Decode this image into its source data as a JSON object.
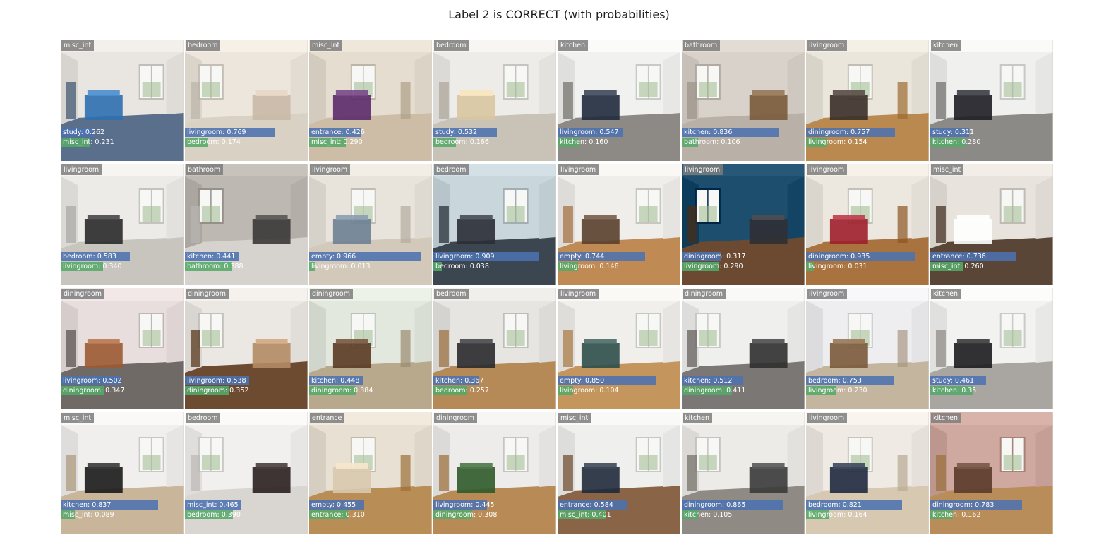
{
  "title": "Label 2 is CORRECT (with probabilities)",
  "colors": {
    "label_bg": "#7d7d7d",
    "pred1_bar": "#4c72b0",
    "pred2_bar": "#55a868"
  },
  "tiles": [
    {
      "label": "misc_int",
      "p1": "study: 0.262",
      "v1": 0.262,
      "p2": "misc_int: 0.231",
      "v2": 0.231,
      "scene": "room",
      "wall": "#e9e6e1",
      "floor": "#5a6f8c",
      "accent": "#2d6fb0"
    },
    {
      "label": "bedroom",
      "p1": "livingroom: 0.769",
      "v1": 0.769,
      "p2": "bedroom: 0.174",
      "v2": 0.174,
      "scene": "room",
      "wall": "#ece6dc",
      "floor": "#d9d1c4",
      "accent": "#c9b8a6"
    },
    {
      "label": "misc_int",
      "p1": "entrance: 0.426",
      "v1": 0.426,
      "p2": "misc_int: 0.290",
      "v2": 0.29,
      "scene": "room",
      "wall": "#e5ddd0",
      "floor": "#cdbda6",
      "accent": "#5b2a6b"
    },
    {
      "label": "bedroom",
      "p1": "study: 0.532",
      "v1": 0.532,
      "p2": "bedroom: 0.166",
      "v2": 0.166,
      "scene": "room",
      "wall": "#eeece8",
      "floor": "#c9c2b6",
      "accent": "#d8c7a0"
    },
    {
      "label": "kitchen",
      "p1": "livingroom: 0.547",
      "v1": 0.547,
      "p2": "kitchen: 0.160",
      "v2": 0.16,
      "scene": "room",
      "wall": "#f1f1f0",
      "floor": "#8d8a85",
      "accent": "#1f2a3c"
    },
    {
      "label": "bathroom",
      "p1": "kitchen: 0.836",
      "v1": 0.836,
      "p2": "bathroom: 0.106",
      "v2": 0.106,
      "scene": "room",
      "wall": "#d8d2ca",
      "floor": "#b9b1a7",
      "accent": "#7a5a3a"
    },
    {
      "label": "livingroom",
      "p1": "diningroom: 0.757",
      "v1": 0.757,
      "p2": "livingroom: 0.154",
      "v2": 0.154,
      "scene": "room",
      "wall": "#ebe6dc",
      "floor": "#b9894f",
      "accent": "#3a2f28"
    },
    {
      "label": "kitchen",
      "p1": "study: 0.311",
      "v1": 0.311,
      "p2": "kitchen: 0.280",
      "v2": 0.28,
      "scene": "room",
      "wall": "#f0f0ee",
      "floor": "#8c8a87",
      "accent": "#1d1d24"
    },
    {
      "label": "livingroom",
      "p1": "bedroom: 0.583",
      "v1": 0.583,
      "p2": "livingroom: 0.340",
      "v2": 0.34,
      "scene": "room",
      "wall": "#ecebe8",
      "floor": "#c8c4be",
      "accent": "#2a2a2a"
    },
    {
      "label": "bathroom",
      "p1": "kitchen: 0.441",
      "v1": 0.441,
      "p2": "bathroom: 0.388",
      "v2": 0.388,
      "scene": "room",
      "wall": "#bdb8b2",
      "floor": "#d6d3cf",
      "accent": "#3a3836"
    },
    {
      "label": "livingroom",
      "p1": "empty: 0.966",
      "v1": 0.966,
      "p2": "livingroom: 0.013",
      "v2": 0.013,
      "scene": "room",
      "wall": "#e8e4dc",
      "floor": "#d2c9bb",
      "accent": "#6d7f93"
    },
    {
      "label": "bedroom",
      "p1": "livingroom: 0.909",
      "v1": 0.909,
      "p2": "bedroom: 0.038",
      "v2": 0.038,
      "scene": "room",
      "wall": "#c9d6dc",
      "floor": "#3c4650",
      "accent": "#2a2f36"
    },
    {
      "label": "livingroom",
      "p1": "empty: 0.744",
      "v1": 0.744,
      "p2": "livingroom: 0.146",
      "v2": 0.146,
      "scene": "room",
      "wall": "#efeeeb",
      "floor": "#c08a55",
      "accent": "#5a3f2d"
    },
    {
      "label": "livingroom",
      "p1": "diningroom: 0.317",
      "v1": 0.317,
      "p2": "livingroom: 0.290",
      "v2": 0.29,
      "scene": "room",
      "wall": "#1e4e6e",
      "floor": "#6b4a31",
      "accent": "#2f2f33"
    },
    {
      "label": "livingroom",
      "p1": "diningroom: 0.935",
      "v1": 0.935,
      "p2": "livingroom: 0.031",
      "v2": 0.031,
      "scene": "room",
      "wall": "#ece7df",
      "floor": "#a9733f",
      "accent": "#9e1f2c"
    },
    {
      "label": "misc_int",
      "p1": "entrance: 0.736",
      "v1": 0.736,
      "p2": "misc_int: 0.260",
      "v2": 0.26,
      "scene": "room",
      "wall": "#e8e4dd",
      "floor": "#5a4636",
      "accent": "#ffffff"
    },
    {
      "label": "diningroom",
      "p1": "livingroom: 0.502",
      "v1": 0.502,
      "p2": "diningroom: 0.347",
      "v2": 0.347,
      "scene": "room",
      "wall": "#e8dede",
      "floor": "#6f6a66",
      "accent": "#9b5a33"
    },
    {
      "label": "diningroom",
      "p1": "livingroom: 0.538",
      "v1": 0.538,
      "p2": "diningroom: 0.352",
      "v2": 0.352,
      "scene": "room",
      "wall": "#ebe8e3",
      "floor": "#6d4b30",
      "accent": "#b38b63"
    },
    {
      "label": "diningroom",
      "p1": "kitchen: 0.448",
      "v1": 0.448,
      "p2": "diningroom: 0.384",
      "v2": 0.384,
      "scene": "room",
      "wall": "#e3e8df",
      "floor": "#b8a88c",
      "accent": "#5a3a22"
    },
    {
      "label": "bedroom",
      "p1": "kitchen: 0.367",
      "v1": 0.367,
      "p2": "bedroom: 0.257",
      "v2": 0.257,
      "scene": "room",
      "wall": "#e6e5e2",
      "floor": "#b68a56",
      "accent": "#2a2a2e"
    },
    {
      "label": "livingroom",
      "p1": "empty: 0.850",
      "v1": 0.85,
      "p2": "livingroom: 0.104",
      "v2": 0.104,
      "scene": "room",
      "wall": "#f0efec",
      "floor": "#c4955c",
      "accent": "#2d4e4a"
    },
    {
      "label": "diningroom",
      "p1": "kitchen: 0.512",
      "v1": 0.512,
      "p2": "diningroom: 0.411",
      "v2": 0.411,
      "scene": "room",
      "wall": "#efefed",
      "floor": "#7a7774",
      "accent": "#2f2f2f"
    },
    {
      "label": "livingroom",
      "p1": "bedroom: 0.753",
      "v1": 0.753,
      "p2": "livingroom: 0.230",
      "v2": 0.23,
      "scene": "room",
      "wall": "#eeeef0",
      "floor": "#c4b59e",
      "accent": "#7a5a3a"
    },
    {
      "label": "kitchen",
      "p1": "study: 0.461",
      "v1": 0.461,
      "p2": "kitchen: 0.35",
      "v2": 0.35,
      "scene": "room",
      "wall": "#f2f2f0",
      "floor": "#a9a6a1",
      "accent": "#1c1c1e"
    },
    {
      "label": "misc_int",
      "p1": "kitchen: 0.837",
      "v1": 0.837,
      "p2": "misc_int: 0.089",
      "v2": 0.089,
      "scene": "room",
      "wall": "#f0efed",
      "floor": "#c9b69a",
      "accent": "#1a1a1a"
    },
    {
      "label": "bedroom",
      "p1": "misc_int: 0.465",
      "v1": 0.465,
      "p2": "bedroom: 0.390",
      "v2": 0.39,
      "scene": "room",
      "wall": "#f1f0ee",
      "floor": "#d9d6d2",
      "accent": "#2a1f1f"
    },
    {
      "label": "entrance",
      "p1": "empty: 0.455",
      "v1": 0.455,
      "p2": "entrance: 0.310",
      "v2": 0.31,
      "scene": "room",
      "wall": "#e8e0d2",
      "floor": "#b98d56",
      "accent": "#d8c9ae"
    },
    {
      "label": "diningroom",
      "p1": "livingroom: 0.445",
      "v1": 0.445,
      "p2": "diningroom: 0.308",
      "v2": 0.308,
      "scene": "room",
      "wall": "#eeecea",
      "floor": "#b88a55",
      "accent": "#2f5a2a"
    },
    {
      "label": "misc_int",
      "p1": "entrance: 0.584",
      "v1": 0.584,
      "p2": "misc_int: 0.401",
      "v2": 0.401,
      "scene": "room",
      "wall": "#efefed",
      "floor": "#8a6446",
      "accent": "#1f2a3a"
    },
    {
      "label": "kitchen",
      "p1": "diningroom: 0.865",
      "v1": 0.865,
      "p2": "kitchen: 0.105",
      "v2": 0.105,
      "scene": "room",
      "wall": "#ecebe8",
      "floor": "#8f8a83",
      "accent": "#3a3a3a"
    },
    {
      "label": "livingroom",
      "p1": "bedroom: 0.821",
      "v1": 0.821,
      "p2": "livingroom: 0.164",
      "v2": 0.164,
      "scene": "room",
      "wall": "#efebe4",
      "floor": "#d6c8b1",
      "accent": "#1f2a3f"
    },
    {
      "label": "kitchen",
      "p1": "diningroom: 0.783",
      "v1": 0.783,
      "p2": "kitchen: 0.162",
      "v2": 0.162,
      "scene": "room",
      "wall": "#cfa9a0",
      "floor": "#b98d5a",
      "accent": "#5a3a2a"
    }
  ]
}
